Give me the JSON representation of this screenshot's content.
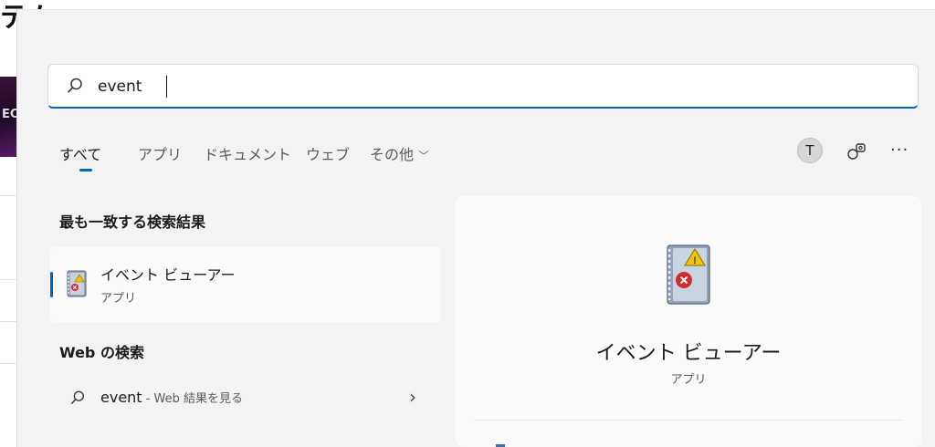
{
  "background": {
    "title_fragment": "テム",
    "thumb_text": "EC"
  },
  "search": {
    "query": "event",
    "icon": "search-icon"
  },
  "tabs": [
    {
      "label": "すべて",
      "active": true
    },
    {
      "label": "アプリ",
      "active": false
    },
    {
      "label": "ドキュメント",
      "active": false
    },
    {
      "label": "ウェブ",
      "active": false
    },
    {
      "label": "その他",
      "active": false,
      "dropdown": true
    }
  ],
  "toolbar": {
    "avatar_initial": "T",
    "rewards_icon": "rewards-icon",
    "more_label": "···"
  },
  "best_match": {
    "section_title": "最も一致する検索結果",
    "name": "イベント ビューアー",
    "type": "アプリ",
    "icon": "event-viewer-icon"
  },
  "web_search": {
    "section_title": "Web の検索",
    "query": "event",
    "suffix": " - Web 結果を見る",
    "arrow": "›"
  },
  "detail": {
    "name": "イベント ビューアー",
    "type": "アプリ",
    "icon": "event-viewer-icon"
  },
  "colors": {
    "accent": "#0067c0",
    "panel_bg": "#f3f3f3",
    "card_bg": "#fbfbfb"
  }
}
